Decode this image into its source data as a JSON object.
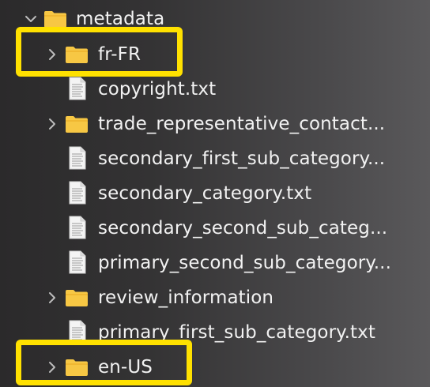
{
  "tree": {
    "root": {
      "label": "metadata",
      "expanded": true
    },
    "items": [
      {
        "label": "fr-FR",
        "type": "folder",
        "expanded": false,
        "highlighted": true
      },
      {
        "label": "copyright.txt",
        "type": "file"
      },
      {
        "label": "trade_representative_contact...",
        "type": "folder",
        "expanded": false
      },
      {
        "label": "secondary_first_sub_category...",
        "type": "file"
      },
      {
        "label": "secondary_category.txt",
        "type": "file"
      },
      {
        "label": "secondary_second_sub_categ...",
        "type": "file"
      },
      {
        "label": "primary_second_sub_category...",
        "type": "file"
      },
      {
        "label": "review_information",
        "type": "folder",
        "expanded": false
      },
      {
        "label": "primary_first_sub_category.txt",
        "type": "file"
      },
      {
        "label": "en-US",
        "type": "folder",
        "expanded": false,
        "highlighted": true
      }
    ]
  },
  "colors": {
    "highlight": "#ffe100",
    "folder": "#f7c744",
    "text": "#f2f2f2"
  }
}
